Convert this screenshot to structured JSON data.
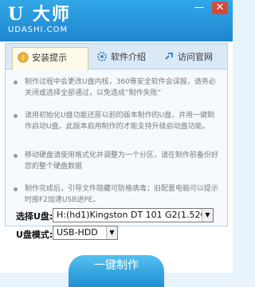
{
  "app": {
    "logo_text": "U 大师",
    "logo_sub": "UDASHI.COM"
  },
  "titlebar": {
    "minimize_glyph": "—",
    "close_glyph": "✕"
  },
  "tabs": [
    {
      "label": "安装提示",
      "icon": "warning-icon"
    },
    {
      "label": "软件介绍",
      "icon": "gear-icon"
    },
    {
      "label": "访问官网",
      "icon": "link-icon"
    }
  ],
  "tips": [
    "制作过程中会更改U盘内核，360等安全软件会误报，请务必关闭或选择全部通过，以免造成“制作失败”",
    "请用初始化U盘功能还原以前的版本制作的U盘，并用一键制作启动U盘。此版本启用制作的才能支持升级启动盘功能。",
    "移动硬盘请使用格式化并调整为一个分区，请在制作前备份好您的整个硬盘数据",
    "制作完成后，引导文件隐藏可防格病毒；旧配置电脑可以提示时按F2加速USB进PE。"
  ],
  "form": {
    "udisk_label": "选择U盘:",
    "udisk_value": "H:(hd1)Kingston DT 101 G2(1.52G)",
    "mode_label": "U盘模式:",
    "mode_value": "USB-HDD"
  },
  "action": {
    "make_button_label": "一键制作"
  },
  "colors": {
    "accent": "#1f86cf",
    "tab_active_bg": "#fffbe9",
    "tip_text": "#7a7a7a"
  }
}
